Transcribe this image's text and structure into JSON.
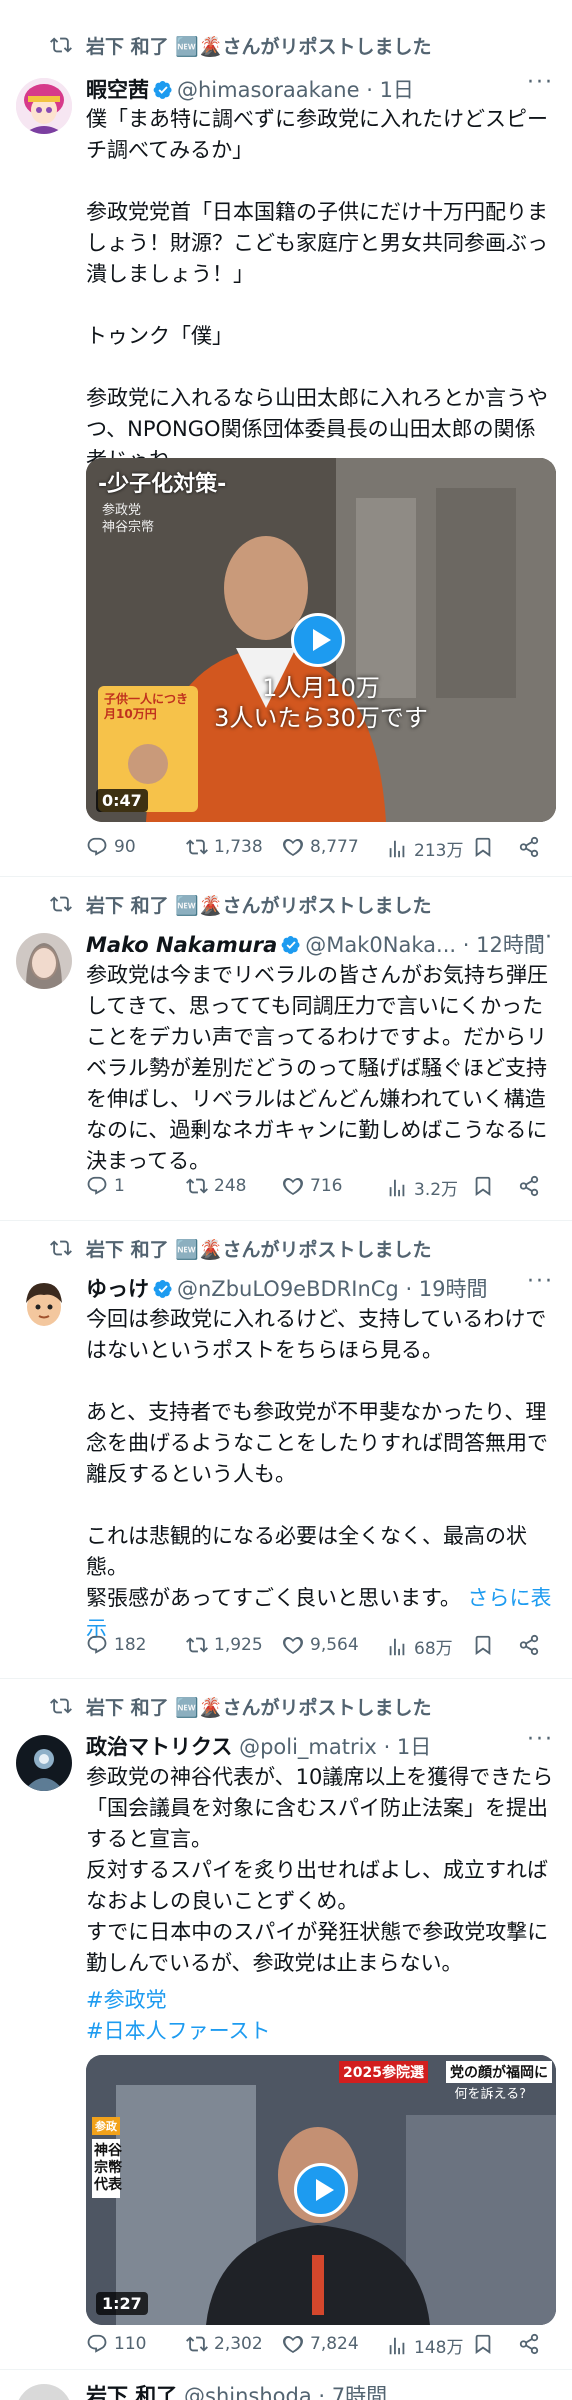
{
  "repost_label": "岩下 和了 🆕🌋さんがリポストしました",
  "posts": [
    {
      "name": "暇空茜",
      "handle": "@himasoraakane",
      "time": "· 1日",
      "text": "僕「まあ特に調べずに参政党に入れたけどスピーチ調べてみるか」\n\n参政党党首「日本国籍の子供にだけ十万円配りましょう！財源？こども家庭庁と男女共同参画ぶっ潰しましょう！」\n\nトゥンク「僕」\n\n参政党に入れるなら山田太郎に入れろとか言うやつ、NPONGO関係団体委員長の山田太郎の関係者じゃね",
      "video": {
        "duration": "0:47",
        "caption_top": "-少子化対策-",
        "caption_side": "参政党\n神谷宗幣",
        "subtitle_1": "1人月10万",
        "subtitle_2": "3人いたら30万です",
        "thumb_text": "子供一人につき\n月10万円"
      },
      "replies": "90",
      "reposts": "1,738",
      "likes": "8,777",
      "views": "213万"
    },
    {
      "name": "Mako Nakamura",
      "handle": "@Mak0Naka...",
      "time": "· 12時間",
      "text": "参政党は今までリベラルの皆さんがお気持ち弾圧してきて、思ってても同調圧力で言いにくかったことをデカい声で言ってるわけですよ。だからリベラル勢が差別だどうのって騒げば騒ぐほど支持を伸ばし、リベラルはどんどん嫌われていく構造なのに、過剰なネガキャンに勤しめばこうなるに決まってる。",
      "replies": "1",
      "reposts": "248",
      "likes": "716",
      "views": "3.2万"
    },
    {
      "name": "ゆっけ",
      "handle": "@nZbuLO9eBDRInCg",
      "time": "· 19時間",
      "text": "今回は参政党に入れるけど、支持しているわけではないというポストをちらほら見る。\n\nあと、支持者でも参政党が不甲斐なかったり、理念を曲げるようなことをしたりすれば問答無用で離反するという人も。\n\nこれは悲観的になる必要は全くなく、最高の状態。\n緊張感があってすごく良いと思います。",
      "more_link": "さらに表示",
      "replies": "182",
      "reposts": "1,925",
      "likes": "9,564",
      "views": "68万"
    },
    {
      "name": "政治マトリクス",
      "handle": "@poli_matrix",
      "time": "· 1日",
      "text": "参政党の神谷代表が、10議席以上を獲得できたら「国会議員を対象に含むスパイ防止法案」を提出すると宣言。\n反対するスパイを炙り出せればよし、成立すればなおよしの良いことずくめ。\nすでに日本中のスパイが発狂状態で参政党攻撃に勤しんでいるが、参政党は止まらない。",
      "hashtags": [
        "#参政党",
        "#日本人ファースト"
      ],
      "video": {
        "duration": "1:27",
        "badge": "2025参院選",
        "headline": "党の顔が福岡に",
        "subhead": "何を訴える?",
        "tag_small": "参政",
        "name_vertical": "神谷\n宗幣\n代表"
      },
      "replies": "110",
      "reposts": "2,302",
      "likes": "7,824",
      "views": "148万"
    }
  ],
  "partial_post": {
    "name": "岩下 和了",
    "handle": "@shinshoda",
    "time": "· 7時間"
  },
  "colors": {
    "accent": "#1d9bf0",
    "muted": "#536471",
    "text": "#0f1419"
  }
}
